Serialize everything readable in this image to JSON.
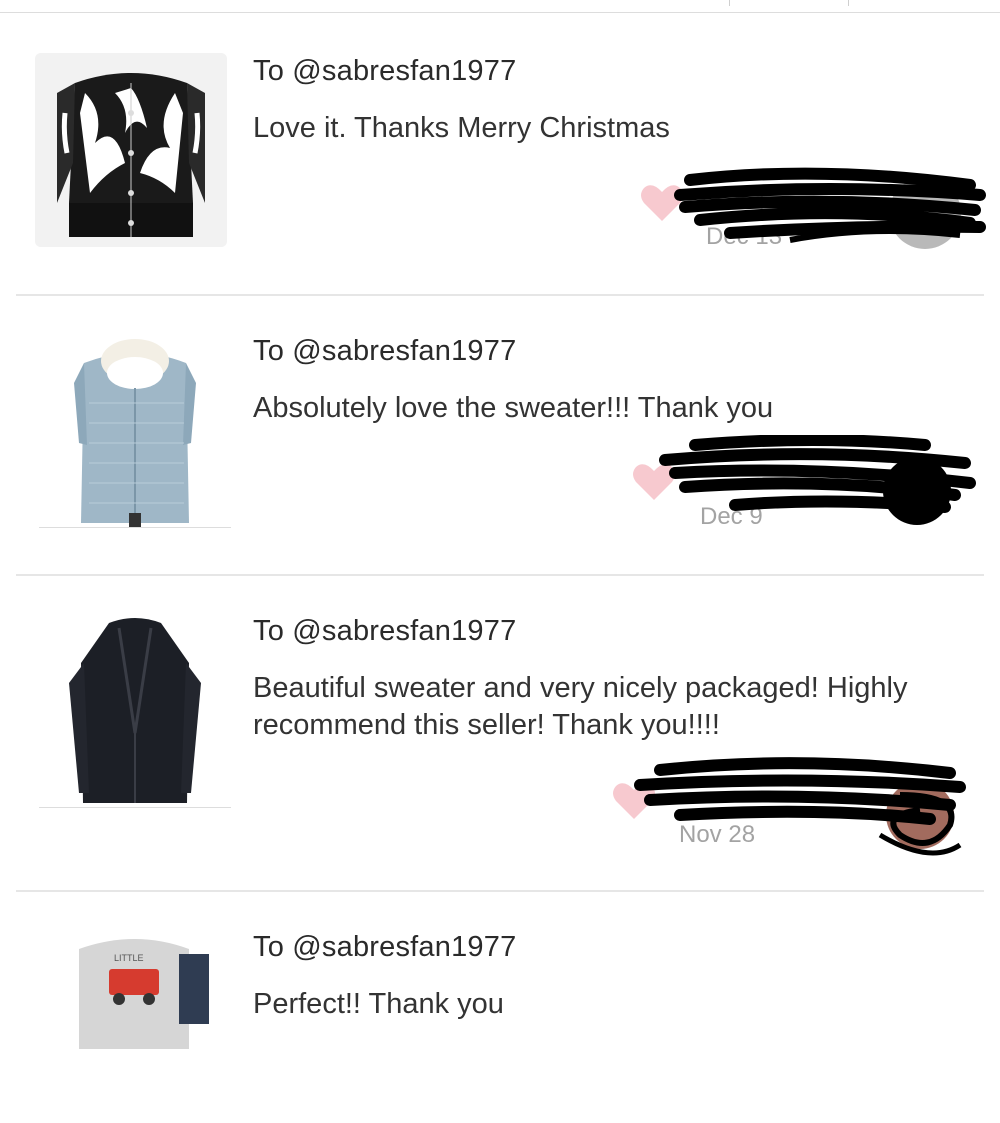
{
  "feed": {
    "items": [
      {
        "recipient": "To @sabresfan1977",
        "message": "Love it. Thanks Merry Christmas",
        "date": "Dec 13",
        "thumbnail": "black-white-floral-cardigan"
      },
      {
        "recipient": "To @sabresfan1977",
        "message": "Absolutely love the sweater!!! Thank you",
        "date": "Dec 9",
        "thumbnail": "light-blue-knit-vest-sweater"
      },
      {
        "recipient": "To @sabresfan1977",
        "message": "Beautiful sweater and very nicely packaged! Highly recommend this seller! Thank you!!!!",
        "date": "Nov 28",
        "thumbnail": "black-long-cardigan"
      },
      {
        "recipient": "To @sabresfan1977",
        "message": "Perfect!! Thank you",
        "date": "",
        "thumbnail": "kids-fire-truck-shirt"
      }
    ]
  },
  "colors": {
    "heart": "#f7c9cf",
    "redaction": "#000000",
    "divider": "#e6e6e6",
    "date_text": "#a3a3a3"
  }
}
